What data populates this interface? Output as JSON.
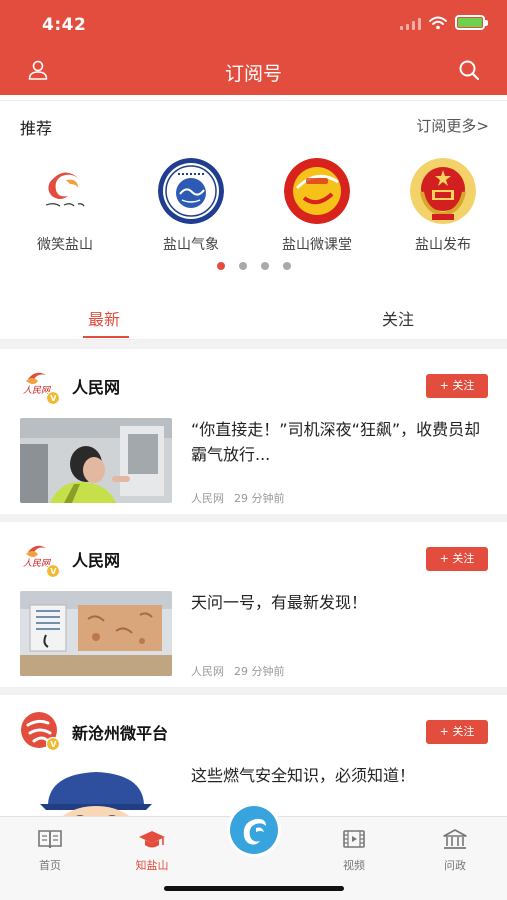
{
  "status_bar": {
    "time": "4:42"
  },
  "nav": {
    "title": "订阅号",
    "user_icon": "user-icon",
    "search_icon": "search-icon"
  },
  "recommend": {
    "title": "推荐",
    "more_label": "订阅更多>",
    "items": [
      {
        "name": "微笑盐山",
        "logo_icon": "smile-yanshan-logo"
      },
      {
        "name": "盐山气象",
        "logo_icon": "weather-bureau-seal"
      },
      {
        "name": "盐山微课堂",
        "logo_icon": "micro-classroom-logo"
      },
      {
        "name": "盐山发布",
        "logo_icon": "national-emblem"
      }
    ],
    "page_count": 4,
    "active_page": 1
  },
  "tabs": [
    {
      "label": "最新",
      "active": true
    },
    {
      "label": "关注",
      "active": false
    }
  ],
  "feed": [
    {
      "source": "人民网",
      "follow_label": "+ 关注",
      "title": "“你直接走！”司机深夜“狂飙”，收费员却霸气放行...",
      "meta_source": "人民网",
      "time": "29 分钟前",
      "thumb_icon": "toll-booth-photo"
    },
    {
      "source": "人民网",
      "follow_label": "+ 关注",
      "title": "天问一号，有最新发现！",
      "meta_source": "人民网",
      "time": "29 分钟前",
      "thumb_icon": "mars-model-photo"
    },
    {
      "source": "新沧州微平台",
      "follow_label": "+ 关注",
      "title": "这些燃气安全知识，必须知道！",
      "thumb_icon": "cartoon-worker-illustration"
    }
  ],
  "tabbar": [
    {
      "label": "首页",
      "icon": "book-icon",
      "active": false
    },
    {
      "label": "知盐山",
      "icon": "graduation-cap-icon",
      "active": true
    },
    {
      "label": "",
      "icon": "center-logo-icon",
      "active": false
    },
    {
      "label": "视频",
      "icon": "film-icon",
      "active": false
    },
    {
      "label": "问政",
      "icon": "government-building-icon",
      "active": false
    }
  ],
  "colors": {
    "brand_red": "#e34d3e",
    "center_blue": "#38a4de",
    "battery_green": "#6ed14b"
  }
}
